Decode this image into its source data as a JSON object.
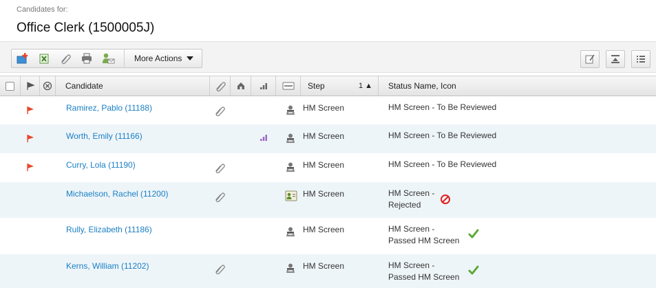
{
  "header": {
    "subtitle": "Candidates for:",
    "title": "Office Clerk (1500005J)"
  },
  "toolbar": {
    "buttons": [
      "add-candidate-icon",
      "export-excel-icon",
      "attachment-icon",
      "print-icon",
      "email-candidate-icon"
    ],
    "more_actions_label": "More Actions",
    "right_buttons": [
      "edit-view-icon",
      "collapse-icon",
      "list-view-icon"
    ]
  },
  "table": {
    "columns": {
      "candidate": "Candidate",
      "step": "Step",
      "sort_indicator": "1 ▲",
      "status": "Status Name, Icon"
    },
    "header_icons": [
      "select-all-checkbox",
      "flag-icon",
      "remove-icon",
      "attachment-icon",
      "home-icon",
      "ranking-icon",
      "card-icon"
    ],
    "rows": [
      {
        "candidate": "Ramirez, Pablo (11188)",
        "flag": true,
        "attachment": true,
        "ranking": false,
        "step_icon": "person-icon",
        "step": "HM Screen",
        "status_line1": "HM Screen - To Be Reviewed",
        "status_line2": "",
        "status_icon": ""
      },
      {
        "candidate": "Worth, Emily (11166)",
        "flag": true,
        "attachment": false,
        "ranking": true,
        "step_icon": "person-icon",
        "step": "HM Screen",
        "status_line1": "HM Screen - To Be Reviewed",
        "status_line2": "",
        "status_icon": ""
      },
      {
        "candidate": "Curry, Lola (11190)",
        "flag": true,
        "attachment": true,
        "ranking": false,
        "step_icon": "person-icon",
        "step": "HM Screen",
        "status_line1": "HM Screen - To Be Reviewed",
        "status_line2": "",
        "status_icon": ""
      },
      {
        "candidate": "Michaelson, Rachel (11200)",
        "flag": false,
        "attachment": true,
        "ranking": false,
        "step_icon": "id-card-icon",
        "step": "HM Screen",
        "status_line1": "HM Screen -",
        "status_line2": "Rejected",
        "status_icon": "rejected-icon"
      },
      {
        "candidate": "Rully, Elizabeth (11186)",
        "flag": false,
        "attachment": false,
        "ranking": false,
        "step_icon": "person-icon",
        "step": "HM Screen",
        "status_line1": "HM Screen -",
        "status_line2": "Passed HM Screen",
        "status_icon": "passed-check-icon"
      },
      {
        "candidate": "Kerns, William (11202)",
        "flag": false,
        "attachment": true,
        "ranking": false,
        "step_icon": "person-icon",
        "step": "HM Screen",
        "status_line1": "HM Screen -",
        "status_line2": "Passed HM Screen",
        "status_icon": "passed-check-icon"
      }
    ]
  },
  "colors": {
    "link": "#1a7fc4",
    "flag": "#e8472b",
    "rejected": "#e02020",
    "passed": "#5aa832",
    "row_alt": "#eef5f9"
  }
}
